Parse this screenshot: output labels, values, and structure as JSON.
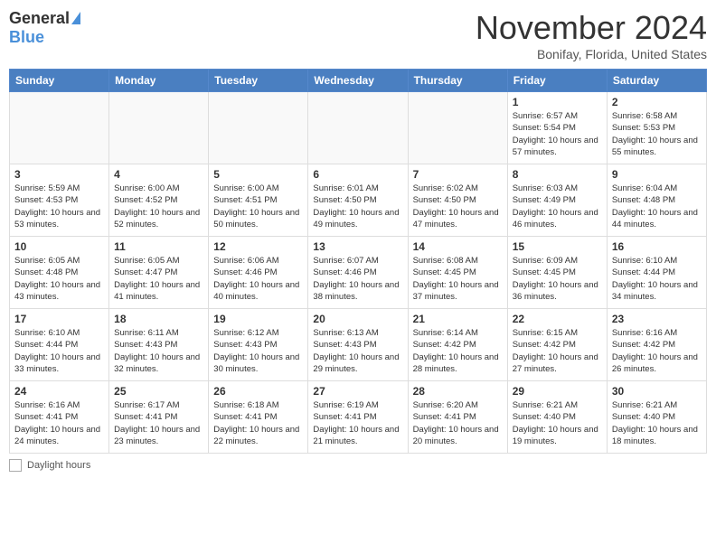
{
  "header": {
    "logo_general": "General",
    "logo_blue": "Blue",
    "month_title": "November 2024",
    "location": "Bonifay, Florida, United States"
  },
  "legend": {
    "label": "Daylight hours"
  },
  "days_of_week": [
    "Sunday",
    "Monday",
    "Tuesday",
    "Wednesday",
    "Thursday",
    "Friday",
    "Saturday"
  ],
  "weeks": [
    [
      {
        "day": "",
        "info": ""
      },
      {
        "day": "",
        "info": ""
      },
      {
        "day": "",
        "info": ""
      },
      {
        "day": "",
        "info": ""
      },
      {
        "day": "",
        "info": ""
      },
      {
        "day": "1",
        "info": "Sunrise: 6:57 AM\nSunset: 5:54 PM\nDaylight: 10 hours and 57 minutes."
      },
      {
        "day": "2",
        "info": "Sunrise: 6:58 AM\nSunset: 5:53 PM\nDaylight: 10 hours and 55 minutes."
      }
    ],
    [
      {
        "day": "3",
        "info": "Sunrise: 5:59 AM\nSunset: 4:53 PM\nDaylight: 10 hours and 53 minutes."
      },
      {
        "day": "4",
        "info": "Sunrise: 6:00 AM\nSunset: 4:52 PM\nDaylight: 10 hours and 52 minutes."
      },
      {
        "day": "5",
        "info": "Sunrise: 6:00 AM\nSunset: 4:51 PM\nDaylight: 10 hours and 50 minutes."
      },
      {
        "day": "6",
        "info": "Sunrise: 6:01 AM\nSunset: 4:50 PM\nDaylight: 10 hours and 49 minutes."
      },
      {
        "day": "7",
        "info": "Sunrise: 6:02 AM\nSunset: 4:50 PM\nDaylight: 10 hours and 47 minutes."
      },
      {
        "day": "8",
        "info": "Sunrise: 6:03 AM\nSunset: 4:49 PM\nDaylight: 10 hours and 46 minutes."
      },
      {
        "day": "9",
        "info": "Sunrise: 6:04 AM\nSunset: 4:48 PM\nDaylight: 10 hours and 44 minutes."
      }
    ],
    [
      {
        "day": "10",
        "info": "Sunrise: 6:05 AM\nSunset: 4:48 PM\nDaylight: 10 hours and 43 minutes."
      },
      {
        "day": "11",
        "info": "Sunrise: 6:05 AM\nSunset: 4:47 PM\nDaylight: 10 hours and 41 minutes."
      },
      {
        "day": "12",
        "info": "Sunrise: 6:06 AM\nSunset: 4:46 PM\nDaylight: 10 hours and 40 minutes."
      },
      {
        "day": "13",
        "info": "Sunrise: 6:07 AM\nSunset: 4:46 PM\nDaylight: 10 hours and 38 minutes."
      },
      {
        "day": "14",
        "info": "Sunrise: 6:08 AM\nSunset: 4:45 PM\nDaylight: 10 hours and 37 minutes."
      },
      {
        "day": "15",
        "info": "Sunrise: 6:09 AM\nSunset: 4:45 PM\nDaylight: 10 hours and 36 minutes."
      },
      {
        "day": "16",
        "info": "Sunrise: 6:10 AM\nSunset: 4:44 PM\nDaylight: 10 hours and 34 minutes."
      }
    ],
    [
      {
        "day": "17",
        "info": "Sunrise: 6:10 AM\nSunset: 4:44 PM\nDaylight: 10 hours and 33 minutes."
      },
      {
        "day": "18",
        "info": "Sunrise: 6:11 AM\nSunset: 4:43 PM\nDaylight: 10 hours and 32 minutes."
      },
      {
        "day": "19",
        "info": "Sunrise: 6:12 AM\nSunset: 4:43 PM\nDaylight: 10 hours and 30 minutes."
      },
      {
        "day": "20",
        "info": "Sunrise: 6:13 AM\nSunset: 4:43 PM\nDaylight: 10 hours and 29 minutes."
      },
      {
        "day": "21",
        "info": "Sunrise: 6:14 AM\nSunset: 4:42 PM\nDaylight: 10 hours and 28 minutes."
      },
      {
        "day": "22",
        "info": "Sunrise: 6:15 AM\nSunset: 4:42 PM\nDaylight: 10 hours and 27 minutes."
      },
      {
        "day": "23",
        "info": "Sunrise: 6:16 AM\nSunset: 4:42 PM\nDaylight: 10 hours and 26 minutes."
      }
    ],
    [
      {
        "day": "24",
        "info": "Sunrise: 6:16 AM\nSunset: 4:41 PM\nDaylight: 10 hours and 24 minutes."
      },
      {
        "day": "25",
        "info": "Sunrise: 6:17 AM\nSunset: 4:41 PM\nDaylight: 10 hours and 23 minutes."
      },
      {
        "day": "26",
        "info": "Sunrise: 6:18 AM\nSunset: 4:41 PM\nDaylight: 10 hours and 22 minutes."
      },
      {
        "day": "27",
        "info": "Sunrise: 6:19 AM\nSunset: 4:41 PM\nDaylight: 10 hours and 21 minutes."
      },
      {
        "day": "28",
        "info": "Sunrise: 6:20 AM\nSunset: 4:41 PM\nDaylight: 10 hours and 20 minutes."
      },
      {
        "day": "29",
        "info": "Sunrise: 6:21 AM\nSunset: 4:40 PM\nDaylight: 10 hours and 19 minutes."
      },
      {
        "day": "30",
        "info": "Sunrise: 6:21 AM\nSunset: 4:40 PM\nDaylight: 10 hours and 18 minutes."
      }
    ]
  ]
}
